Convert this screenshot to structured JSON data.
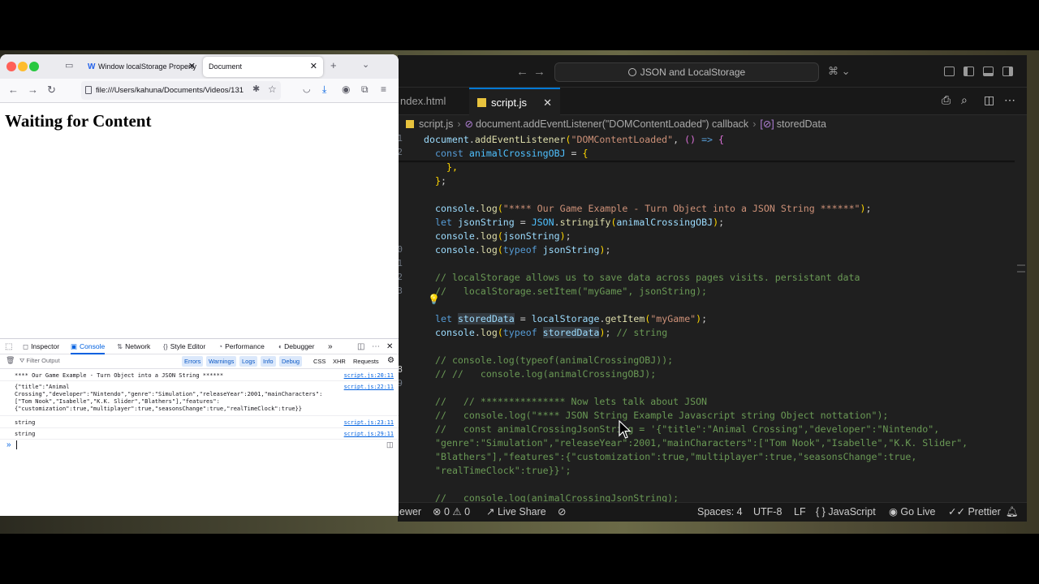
{
  "firefox": {
    "tabs": [
      {
        "title": "Window localStorage Property",
        "favicon": "W"
      },
      {
        "title": "Document"
      }
    ],
    "url": "file:///Users/kahuna/Documents/Videos/131",
    "page_heading": "Waiting for Content",
    "devtools": {
      "tabs": [
        "Inspector",
        "Console",
        "Network",
        "Style Editor",
        "Performance",
        "Debugger"
      ],
      "filter_placeholder": "Filter Output",
      "filters": [
        "Errors",
        "Warnings",
        "Logs",
        "Info",
        "Debug",
        "CSS",
        "XHR",
        "Requests"
      ],
      "logs": [
        {
          "text": "**** Our Game Example - Turn Object into a JSON String ******",
          "source": "script.js:20:11"
        },
        {
          "text": "{\"title\":\"Animal\nCrossing\",\"developer\":\"Nintendo\",\"genre\":\"Simulation\",\"releaseYear\":2001,\"mainCharacters\":\n[\"Tom Nook\",\"Isabelle\",\"K.K. Slider\",\"Blathers\"],\"features\":\n{\"customization\":true,\"multiplayer\":true,\"seasonsChange\":true,\"realTimeClock\":true}}",
          "source": "script.js:22:11"
        },
        {
          "text": "string",
          "source": "script.js:23:11"
        },
        {
          "text": "string",
          "source": "script.js:29:11"
        }
      ],
      "prompt": "»"
    }
  },
  "vscode": {
    "search": "JSON and LocalStorage",
    "tabs": [
      "ndex.html",
      "script.js"
    ],
    "breadcrumb": [
      "script.js",
      "document.addEventListener(\"DOMContentLoaded\") callback",
      "storedData"
    ],
    "line_numbers": [
      "1",
      "2",
      "",
      "",
      "",
      "0",
      "1",
      "2",
      "3",
      "4",
      "",
      "",
      "",
      "",
      "8",
      "9",
      "",
      "",
      "",
      "",
      "",
      "",
      "",
      "",
      "",
      "",
      "7",
      ""
    ],
    "status": {
      "left": [
        "ewer",
        "0",
        "0",
        "Live Share"
      ],
      "right": [
        "Spaces: 4",
        "UTF-8",
        "LF",
        "JavaScript",
        "Go Live",
        "Prettier"
      ]
    }
  },
  "colors": {
    "vscode_bg": "#1f1f1f",
    "accent": "#0078d4",
    "firefox_accent": "#0061e0"
  }
}
